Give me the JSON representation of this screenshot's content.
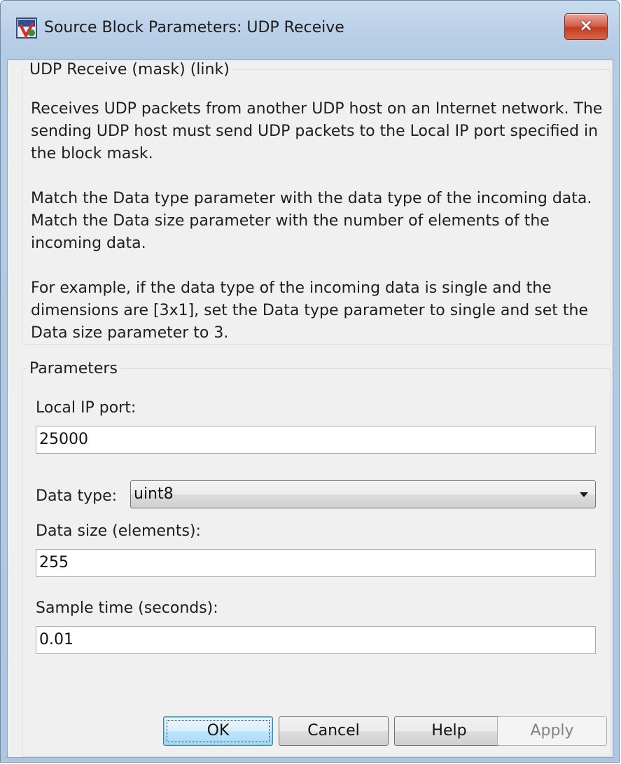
{
  "window": {
    "title": "Source Block Parameters: UDP Receive",
    "close_label": "×"
  },
  "description": {
    "legend": "UDP Receive (mask) (link)",
    "paragraphs": [
      "Receives UDP packets from another UDP host on an Internet network. The sending UDP host must send UDP packets to the Local IP port specified in the block mask.",
      "Match the Data type parameter with the data type of the incoming data. Match the Data size parameter with the number of elements of the incoming data.",
      "For example, if the data type of the incoming data is single and the dimensions are [3x1], set the Data type parameter to single and set the Data size parameter to 3."
    ]
  },
  "parameters": {
    "legend": "Parameters",
    "local_ip_port": {
      "label": "Local IP port:",
      "value": "25000"
    },
    "data_type": {
      "label": "Data type:",
      "value": "uint8"
    },
    "data_size": {
      "label": "Data size (elements):",
      "value": "255"
    },
    "sample_time": {
      "label": "Sample time (seconds):",
      "value": "0.01"
    }
  },
  "buttons": {
    "ok": "OK",
    "cancel": "Cancel",
    "help": "Help",
    "apply": "Apply"
  },
  "colors": {
    "title_gradient": "#c9dcef",
    "client_bg": "#f0f0f0",
    "close_red": "#c43d22",
    "default_button_blue": "#a7d9f5"
  }
}
